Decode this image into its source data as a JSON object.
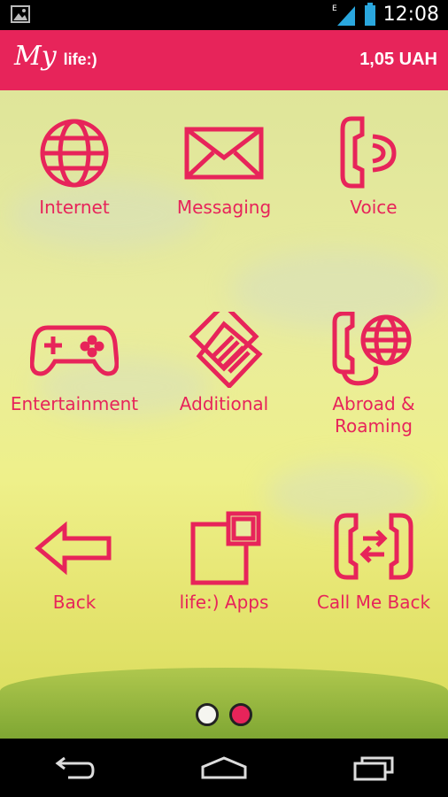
{
  "status": {
    "time": "12:08",
    "network_label": "E"
  },
  "appbar": {
    "brand_my": "My",
    "brand_life": "life:)",
    "balance": "1,05 UAH"
  },
  "tiles": [
    {
      "label": "Internet",
      "icon": "globe-icon"
    },
    {
      "label": "Messaging",
      "icon": "envelope-icon"
    },
    {
      "label": "Voice",
      "icon": "phone-voice-icon"
    },
    {
      "label": "Entertainment",
      "icon": "gamepad-icon"
    },
    {
      "label": "Additional",
      "icon": "additional-services-icon"
    },
    {
      "label": "Abroad &\nRoaming",
      "label_line1": "Abroad &",
      "label_line2": "Roaming",
      "icon": "phone-globe-icon"
    },
    {
      "label": "Back",
      "icon": "back-arrow-icon"
    },
    {
      "label": "life:) Apps",
      "icon": "apps-icon"
    },
    {
      "label": "Call Me Back",
      "icon": "call-me-back-icon"
    }
  ],
  "pager": {
    "pages": 2,
    "active_index": 1
  },
  "colors": {
    "accent": "#e7245a",
    "navbar": "#000000"
  }
}
